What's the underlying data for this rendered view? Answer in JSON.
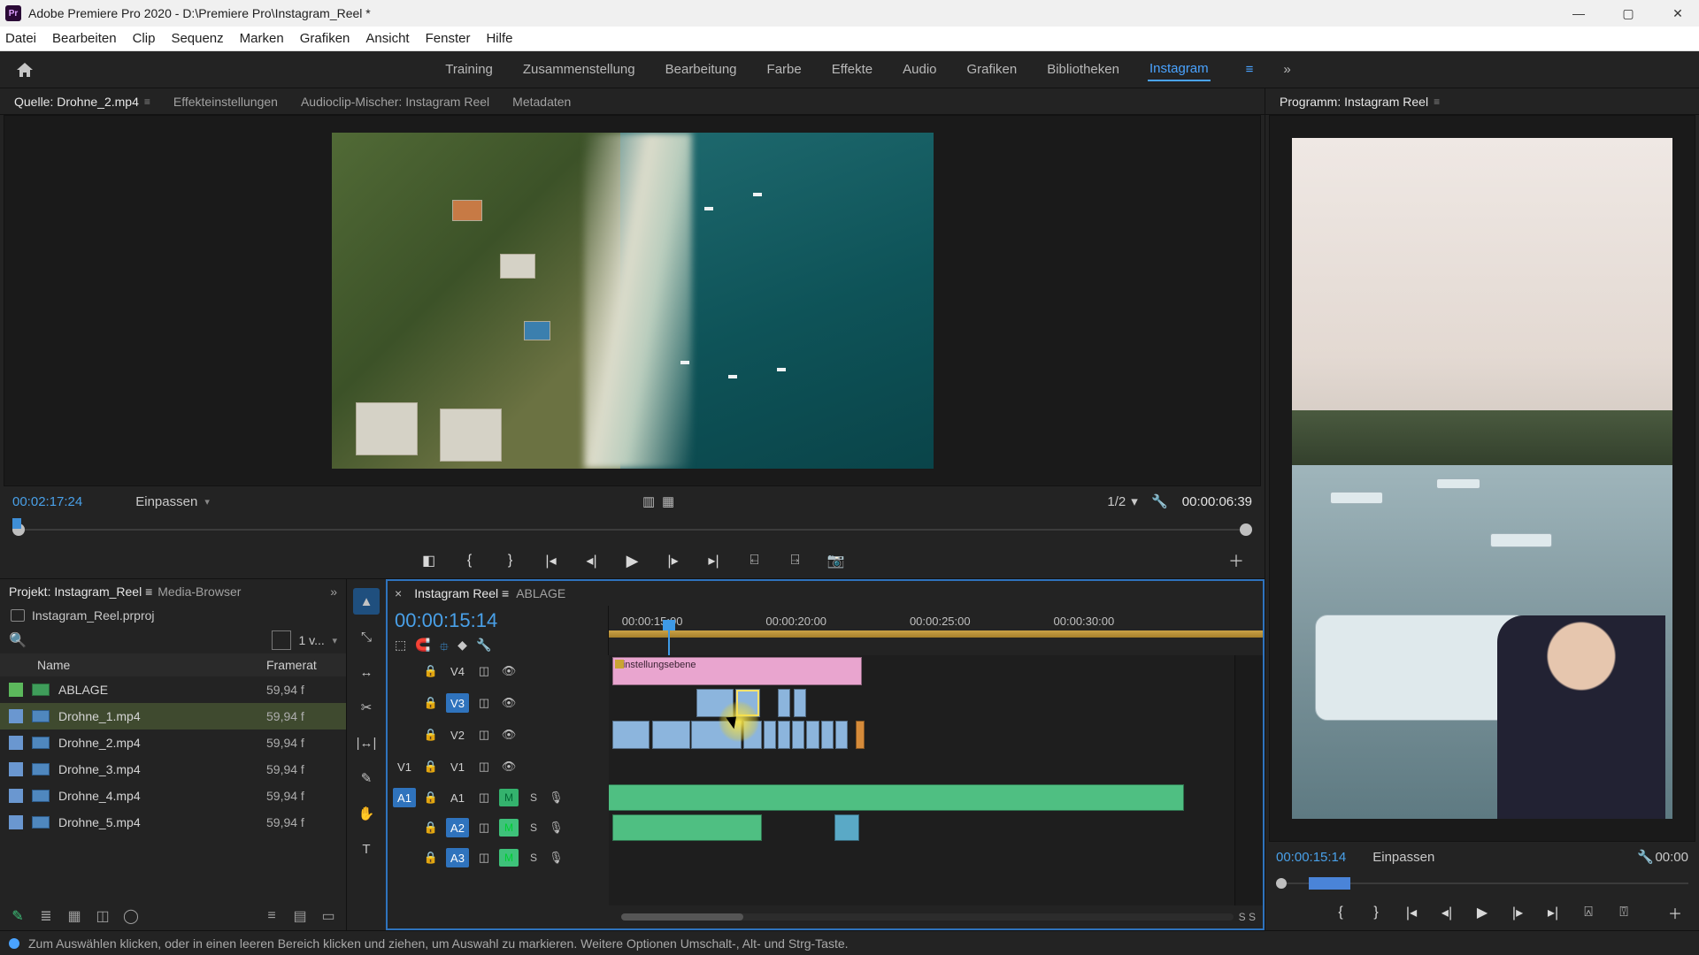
{
  "window": {
    "title": "Adobe Premiere Pro 2020 - D:\\Premiere Pro\\Instagram_Reel *"
  },
  "menu": {
    "items": [
      "Datei",
      "Bearbeiten",
      "Clip",
      "Sequenz",
      "Marken",
      "Grafiken",
      "Ansicht",
      "Fenster",
      "Hilfe"
    ]
  },
  "workspaces": {
    "items": [
      "Training",
      "Zusammenstellung",
      "Bearbeitung",
      "Farbe",
      "Effekte",
      "Audio",
      "Grafiken",
      "Bibliotheken",
      "Instagram"
    ],
    "active": "Instagram"
  },
  "source_panel": {
    "tabs": [
      "Quelle: Drohne_2.mp4",
      "Effekteinstellungen",
      "Audioclip-Mischer: Instagram Reel",
      "Metadaten"
    ],
    "active": 0,
    "tc_in": "00:02:17:24",
    "fit_label": "Einpassen",
    "ratio": "1/2",
    "tc_out": "00:00:06:39"
  },
  "project_panel": {
    "tabs": [
      "Projekt: Instagram_Reel",
      "Media-Browser"
    ],
    "active": 0,
    "project_file": "Instagram_Reel.prproj",
    "view_count_label": "1 v...",
    "columns": {
      "name": "Name",
      "rate": "Framerat"
    },
    "items": [
      {
        "name": "ABLAGE",
        "rate": "59,94 f",
        "type": "seq"
      },
      {
        "name": "Drohne_1.mp4",
        "rate": "59,94 f",
        "type": "clip",
        "selected": true
      },
      {
        "name": "Drohne_2.mp4",
        "rate": "59,94 f",
        "type": "clip"
      },
      {
        "name": "Drohne_3.mp4",
        "rate": "59,94 f",
        "type": "clip"
      },
      {
        "name": "Drohne_4.mp4",
        "rate": "59,94 f",
        "type": "clip"
      },
      {
        "name": "Drohne_5.mp4",
        "rate": "59,94 f",
        "type": "clip"
      }
    ]
  },
  "timeline": {
    "tabs": [
      "Instagram Reel",
      "ABLAGE"
    ],
    "active": 0,
    "playhead_tc": "00:00:15:14",
    "ruler": [
      "00:00:15:00",
      "00:00:20:00",
      "00:00:25:00",
      "00:00:30:00"
    ],
    "video_tracks": [
      "V4",
      "V3",
      "V2",
      "V1"
    ],
    "audio_tracks": [
      "A1",
      "A2",
      "A3"
    ],
    "adjustment_label": "Einstellungsebene",
    "zoom_label": "S  S"
  },
  "program_panel": {
    "title": "Programm: Instagram Reel",
    "tc": "00:00:15:14",
    "fit_label": "Einpassen",
    "tc_right": "00:00"
  },
  "status_bar": {
    "hint": "Zum Auswählen klicken, oder in einen leeren Bereich klicken und ziehen, um Auswahl zu markieren. Weitere Optionen Umschalt-, Alt- und Strg-Taste."
  },
  "icons": {
    "app_badge": "Pr"
  }
}
